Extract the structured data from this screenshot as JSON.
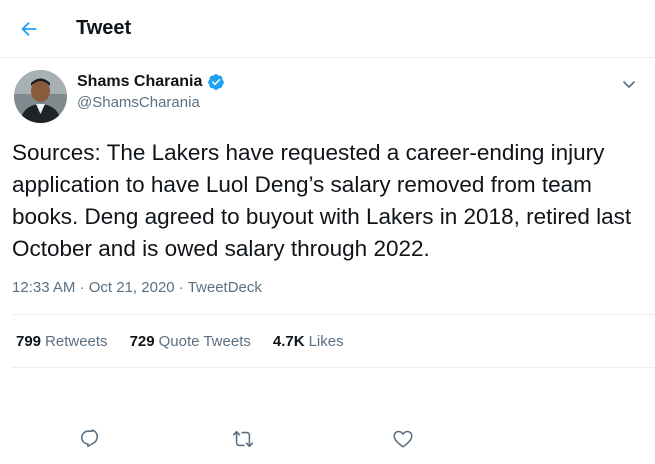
{
  "header": {
    "title": "Tweet",
    "back_icon": "back-arrow-icon"
  },
  "author": {
    "display_name": "Shams Charania",
    "handle": "@ShamsCharania",
    "verified": true
  },
  "tweet": {
    "text": "Sources: The Lakers have requested a career-ending injury application to have Luol Deng’s salary removed from team books. Deng agreed to buyout with Lakers in 2018, retired last October and is owed salary through 2022.",
    "time": "12:33 AM",
    "separator": " · ",
    "date": "Oct 21, 2020",
    "source": "TweetDeck"
  },
  "stats": {
    "retweets_count": "799",
    "retweets_label": "Retweets",
    "quotes_count": "729",
    "quotes_label": "Quote Tweets",
    "likes_count": "4.7K",
    "likes_label": "Likes"
  },
  "actions": [
    "reply-icon",
    "retweet-icon",
    "like-icon"
  ],
  "colors": {
    "accent": "#1da1f2",
    "secondary_text": "#5b7083",
    "primary_text": "#0f1419",
    "divider": "#ebeef0"
  }
}
